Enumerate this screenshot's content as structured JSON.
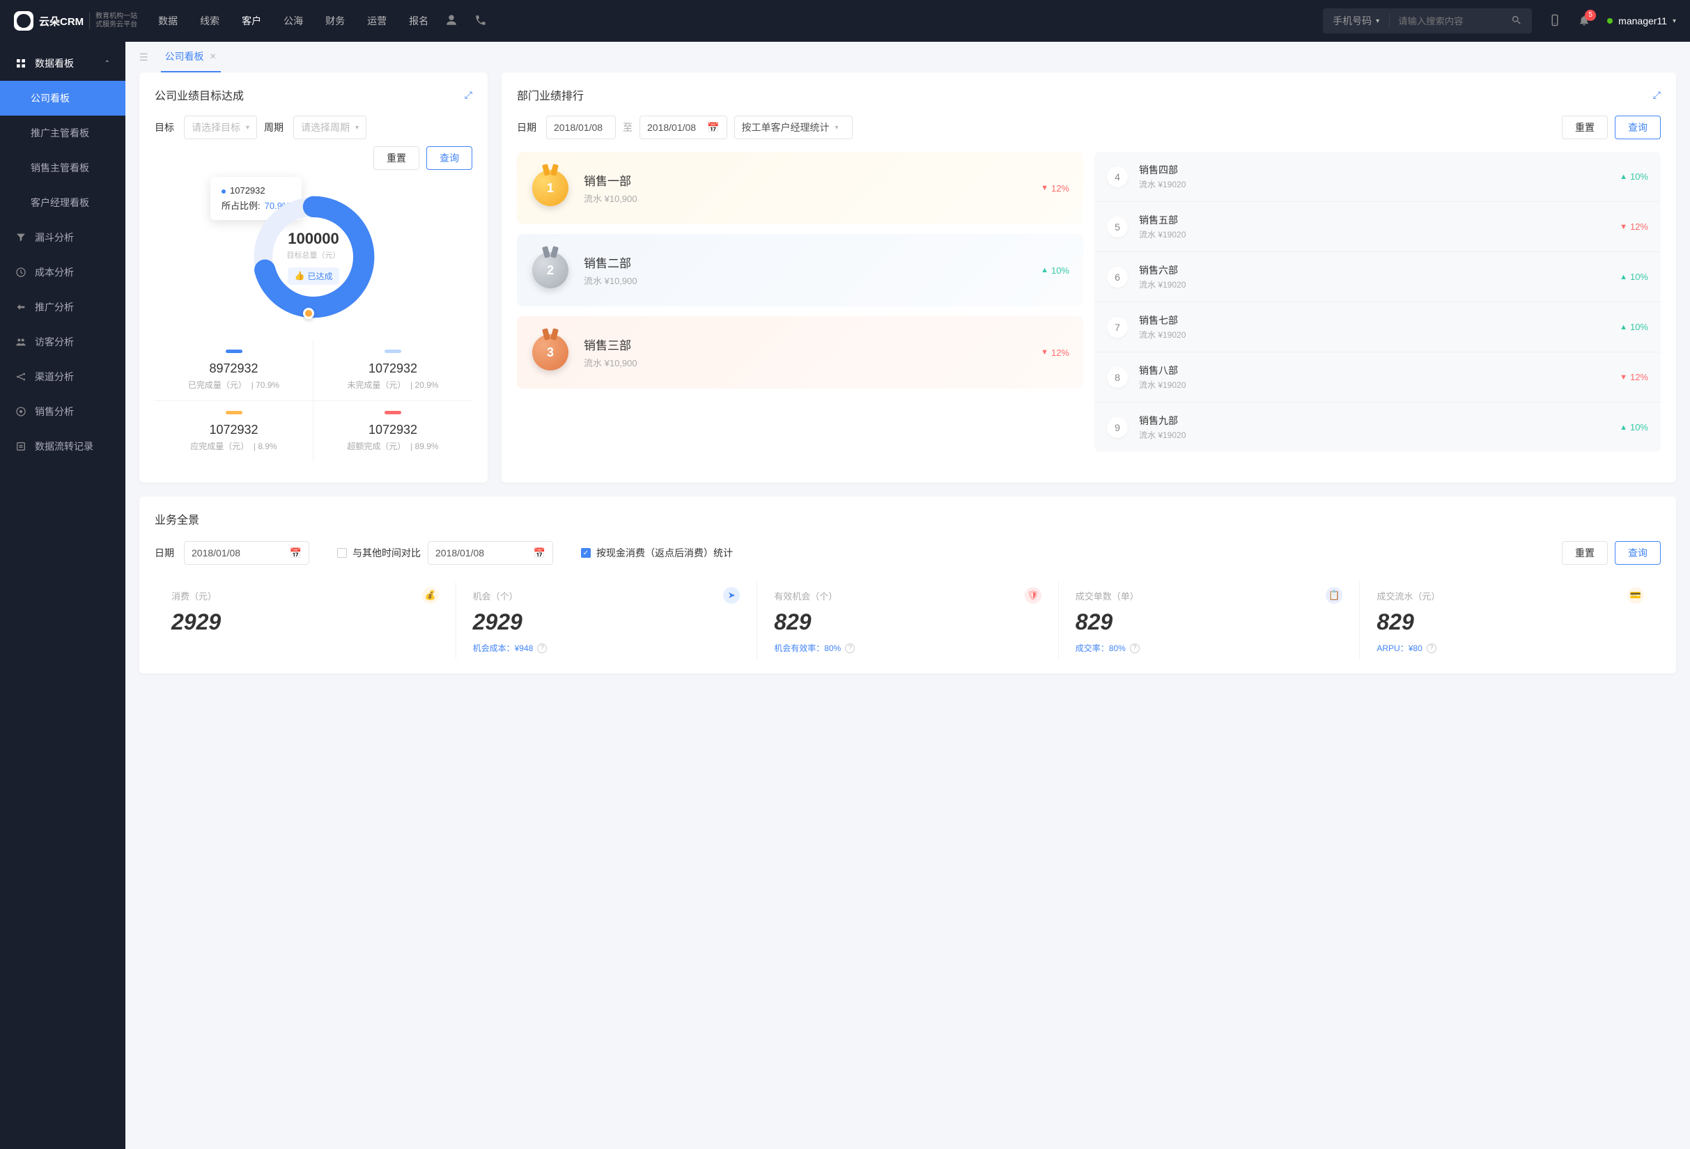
{
  "topnav": {
    "logo": "云朵CRM",
    "logo_sub1": "教育机构一站",
    "logo_sub2": "式服务云平台",
    "links": [
      "数据",
      "线索",
      "客户",
      "公海",
      "财务",
      "运营",
      "报名"
    ],
    "active_link": 2,
    "search_cat": "手机号码",
    "search_placeholder": "请输入搜索内容",
    "notif_count": "5",
    "user": "manager11"
  },
  "sidebar": {
    "header": "数据看板",
    "subs": [
      "公司看板",
      "推广主管看板",
      "销售主管看板",
      "客户经理看板"
    ],
    "active_sub": 0,
    "items": [
      "漏斗分析",
      "成本分析",
      "推广分析",
      "访客分析",
      "渠道分析",
      "销售分析",
      "数据流转记录"
    ]
  },
  "tabs": {
    "tab1": "公司看板"
  },
  "goal": {
    "title": "公司业绩目标达成",
    "lbl_goal": "目标",
    "sel_goal": "请选择目标",
    "lbl_period": "周期",
    "sel_period": "请选择周期",
    "btn_reset": "重置",
    "btn_query": "查询",
    "tooltip_val": "1072932",
    "tooltip_lbl": "所占比例:",
    "tooltip_pct": "70.9%",
    "center_val": "100000",
    "center_sub": "目标总量（元）",
    "tag": "已达成",
    "stats": [
      {
        "color": "#4285f4",
        "num": "8972932",
        "lab": "已完成量（元）",
        "pct": "| 70.9%"
      },
      {
        "color": "#bcd7ff",
        "num": "1072932",
        "lab": "未完成量（元）",
        "pct": "| 20.9%"
      },
      {
        "color": "#ffb84d",
        "num": "1072932",
        "lab": "应完成量（元）",
        "pct": "| 8.9%"
      },
      {
        "color": "#ff6b6b",
        "num": "1072932",
        "lab": "超额完成（元）",
        "pct": "| 89.9%"
      }
    ]
  },
  "rank": {
    "title": "部门业绩排行",
    "lbl_date": "日期",
    "date_from": "2018/01/08",
    "to": "至",
    "date_to": "2018/01/08",
    "sel_by": "按工单客户经理统计",
    "btn_reset": "重置",
    "btn_query": "查询",
    "podium": [
      {
        "rank": "1",
        "name": "销售一部",
        "sub": "流水 ¥10,900",
        "trend": "12%",
        "dir": "down"
      },
      {
        "rank": "2",
        "name": "销售二部",
        "sub": "流水 ¥10,900",
        "trend": "10%",
        "dir": "up"
      },
      {
        "rank": "3",
        "name": "销售三部",
        "sub": "流水 ¥10,900",
        "trend": "12%",
        "dir": "down"
      }
    ],
    "list": [
      {
        "rank": "4",
        "name": "销售四部",
        "sub": "流水 ¥19020",
        "trend": "10%",
        "dir": "up"
      },
      {
        "rank": "5",
        "name": "销售五部",
        "sub": "流水 ¥19020",
        "trend": "12%",
        "dir": "down"
      },
      {
        "rank": "6",
        "name": "销售六部",
        "sub": "流水 ¥19020",
        "trend": "10%",
        "dir": "up"
      },
      {
        "rank": "7",
        "name": "销售七部",
        "sub": "流水 ¥19020",
        "trend": "10%",
        "dir": "up"
      },
      {
        "rank": "8",
        "name": "销售八部",
        "sub": "流水 ¥19020",
        "trend": "12%",
        "dir": "down"
      },
      {
        "rank": "9",
        "name": "销售九部",
        "sub": "流水 ¥19020",
        "trend": "10%",
        "dir": "up"
      }
    ]
  },
  "overview": {
    "title": "业务全景",
    "lbl_date": "日期",
    "date1": "2018/01/08",
    "compare": "与其他时间对比",
    "date2": "2018/01/08",
    "check_lbl": "按现金消费（返点后消费）统计",
    "btn_reset": "重置",
    "btn_query": "查询",
    "metrics": [
      {
        "lab": "消费（元）",
        "val": "2929",
        "ext": "",
        "color": "#ffb84d"
      },
      {
        "lab": "机会（个）",
        "val": "2929",
        "ext": "机会成本：¥948",
        "color": "#4285f4"
      },
      {
        "lab": "有效机会（个）",
        "val": "829",
        "ext": "机会有效率：80%",
        "color": "#ff6b6b"
      },
      {
        "lab": "成交单数（单）",
        "val": "829",
        "ext": "成交率：80%",
        "color": "#5b7cff"
      },
      {
        "lab": "成交流水（元）",
        "val": "829",
        "ext": "ARPU：¥80",
        "color": "#ffb84d"
      }
    ]
  },
  "chart_data": {
    "type": "pie",
    "title": "公司业绩目标达成",
    "total_label": "目标总量（元）",
    "total": 100000,
    "series": [
      {
        "name": "已完成量（元）",
        "value": 8972932,
        "pct": 70.9,
        "color": "#4285f4"
      },
      {
        "name": "未完成量（元）",
        "value": 1072932,
        "pct": 20.9,
        "color": "#bcd7ff"
      },
      {
        "name": "应完成量（元）",
        "value": 1072932,
        "pct": 8.9,
        "color": "#ffb84d"
      },
      {
        "name": "超额完成（元）",
        "value": 1072932,
        "pct": 89.9,
        "color": "#ff6b6b"
      }
    ],
    "highlight": {
      "value": 1072932,
      "pct": 70.9
    }
  }
}
